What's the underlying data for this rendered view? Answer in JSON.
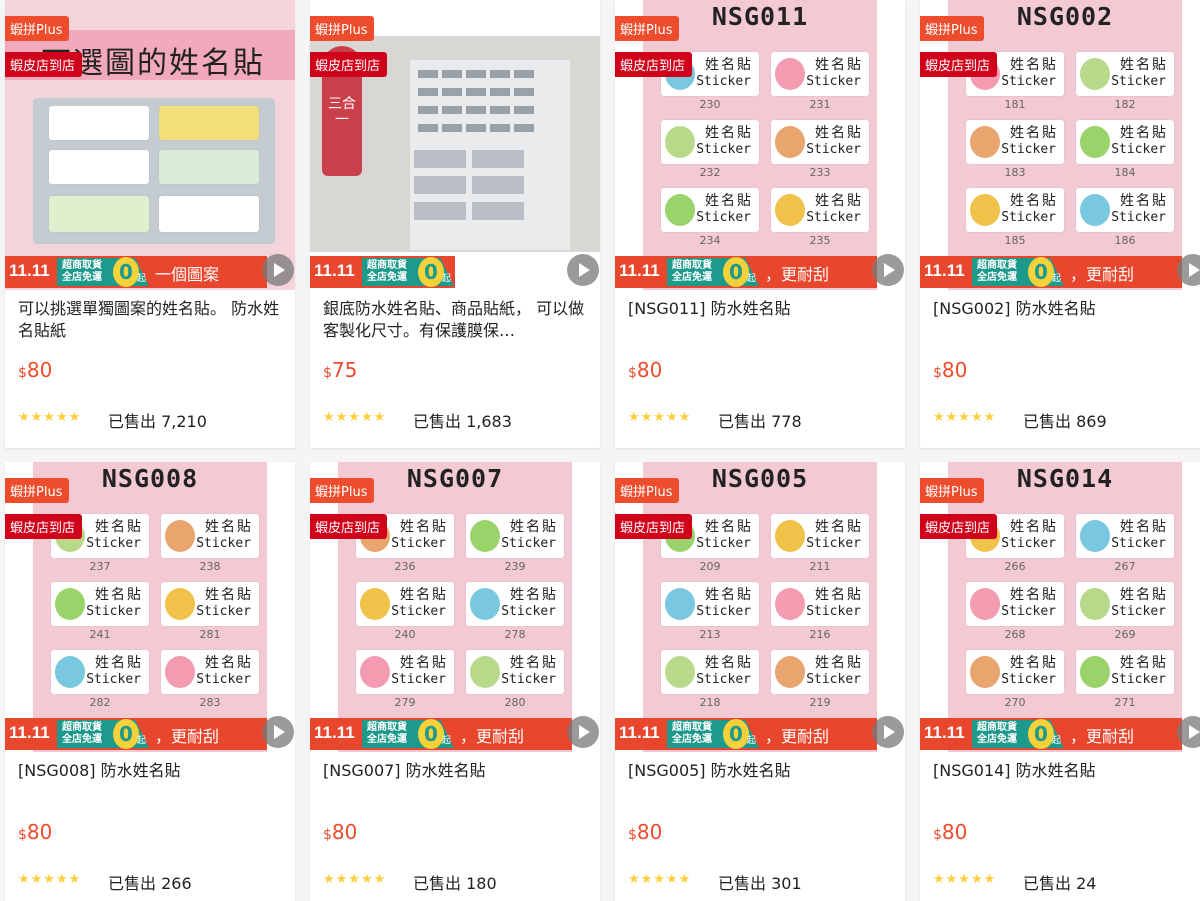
{
  "colors": {
    "brand": "#ee4d2d",
    "promo": "#e8472e",
    "teal": "#1d9a8c",
    "star": "#ffce3d"
  },
  "cards": [
    {
      "tag_plus": "蝦拼Plus",
      "tag_shop": "蝦皮店到店",
      "thumb_heading": "可選圖的姓名貼",
      "promo": {
        "event": "11.11",
        "ship1": "超商取貨",
        "ship2": "全店免運",
        "zero": "0",
        "qi": "起",
        "tail": "一個圖案"
      },
      "title": "可以挑選單獨圖案的姓名貼。 防水姓名貼紙",
      "currency": "$",
      "price": "80",
      "stars": "★★★★★",
      "sold": "已售出 7,210"
    },
    {
      "tag_plus": "蝦拼Plus",
      "tag_shop": "蝦皮店到店",
      "thumb_side": "三合一",
      "promo": {
        "event": "11.11",
        "ship1": "超商取貨",
        "ship2": "全店免運",
        "zero": "0",
        "qi": "起",
        "tail": ""
      },
      "title": "銀底防水姓名貼、商品貼紙， 可以做客製化尺寸。有保護膜保…",
      "currency": "$",
      "price": "75",
      "stars": "★★★★★",
      "sold": "已售出 1,683"
    },
    {
      "tag_plus": "蝦拼Plus",
      "tag_shop": "蝦皮店到店",
      "code": "NSG011",
      "stickers": [
        {
          "name": "姓名貼",
          "en": "Sticker",
          "num": "230"
        },
        {
          "name": "姓名貼",
          "en": "Sticker",
          "num": "231"
        },
        {
          "name": "姓名貼",
          "en": "Sticker",
          "num": "232"
        },
        {
          "name": "姓名貼",
          "en": "Sticker",
          "num": "233"
        },
        {
          "name": "姓名貼",
          "en": "Sticker",
          "num": "234"
        },
        {
          "name": "姓名貼",
          "en": "Sticker",
          "num": "235"
        }
      ],
      "promo": {
        "event": "11.11",
        "ship1": "超商取貨",
        "ship2": "全店免運",
        "zero": "0",
        "qi": "起",
        "tail": "，更耐刮"
      },
      "title": "[NSG011] 防水姓名貼",
      "currency": "$",
      "price": "80",
      "stars": "★★★★★",
      "sold": "已售出 778"
    },
    {
      "tag_plus": "蝦拼Plus",
      "tag_shop": "蝦皮店到店",
      "code": "NSG002",
      "stickers": [
        {
          "name": "姓名貼",
          "en": "Sticker",
          "num": "181"
        },
        {
          "name": "姓名貼",
          "en": "Sticker",
          "num": "182"
        },
        {
          "name": "姓名貼",
          "en": "Sticker",
          "num": "183"
        },
        {
          "name": "姓名貼",
          "en": "Sticker",
          "num": "184"
        },
        {
          "name": "姓名貼",
          "en": "Sticker",
          "num": "185"
        },
        {
          "name": "姓名貼",
          "en": "Sticker",
          "num": "186"
        }
      ],
      "promo": {
        "event": "11.11",
        "ship1": "超商取貨",
        "ship2": "全店免運",
        "zero": "0",
        "qi": "起",
        "tail": "，更耐刮"
      },
      "title": "[NSG002] 防水姓名貼",
      "currency": "$",
      "price": "80",
      "stars": "★★★★★",
      "sold": "已售出 869"
    },
    {
      "tag_plus": "蝦拼Plus",
      "tag_shop": "蝦皮店到店",
      "code": "NSG008",
      "stickers": [
        {
          "name": "姓名貼",
          "en": "Sticker",
          "num": "237"
        },
        {
          "name": "姓名貼",
          "en": "Sticker",
          "num": "238"
        },
        {
          "name": "姓名貼",
          "en": "Sticker",
          "num": "241"
        },
        {
          "name": "姓名貼",
          "en": "Sticker",
          "num": "281"
        },
        {
          "name": "姓名貼",
          "en": "Sticker",
          "num": "282"
        },
        {
          "name": "姓名貼",
          "en": "Sticker",
          "num": "283"
        }
      ],
      "promo": {
        "event": "11.11",
        "ship1": "超商取貨",
        "ship2": "全店免運",
        "zero": "0",
        "qi": "起",
        "tail": "，更耐刮"
      },
      "title": "[NSG008] 防水姓名貼",
      "currency": "$",
      "price": "80",
      "stars": "★★★★★",
      "sold": "已售出 266"
    },
    {
      "tag_plus": "蝦拼Plus",
      "tag_shop": "蝦皮店到店",
      "code": "NSG007",
      "stickers": [
        {
          "name": "姓名貼",
          "en": "Sticker",
          "num": "236"
        },
        {
          "name": "姓名貼",
          "en": "Sticker",
          "num": "239"
        },
        {
          "name": "姓名貼",
          "en": "Sticker",
          "num": "240"
        },
        {
          "name": "姓名貼",
          "en": "Sticker",
          "num": "278"
        },
        {
          "name": "姓名貼",
          "en": "Sticker",
          "num": "279"
        },
        {
          "name": "姓名貼",
          "en": "Sticker",
          "num": "280"
        }
      ],
      "promo": {
        "event": "11.11",
        "ship1": "超商取貨",
        "ship2": "全店免運",
        "zero": "0",
        "qi": "起",
        "tail": "，更耐刮"
      },
      "title": "[NSG007] 防水姓名貼",
      "currency": "$",
      "price": "80",
      "stars": "★★★★★",
      "sold": "已售出 180"
    },
    {
      "tag_plus": "蝦拼Plus",
      "tag_shop": "蝦皮店到店",
      "code": "NSG005",
      "stickers": [
        {
          "name": "姓名貼",
          "en": "Sticker",
          "num": "209"
        },
        {
          "name": "姓名貼",
          "en": "Sticker",
          "num": "211"
        },
        {
          "name": "姓名貼",
          "en": "Sticker",
          "num": "213"
        },
        {
          "name": "姓名貼",
          "en": "Sticker",
          "num": "216"
        },
        {
          "name": "姓名貼",
          "en": "Sticker",
          "num": "218"
        },
        {
          "name": "姓名貼",
          "en": "Sticker",
          "num": "219"
        }
      ],
      "promo": {
        "event": "11.11",
        "ship1": "超商取貨",
        "ship2": "全店免運",
        "zero": "0",
        "qi": "起",
        "tail": "，更耐刮"
      },
      "title": "[NSG005] 防水姓名貼",
      "currency": "$",
      "price": "80",
      "stars": "★★★★★",
      "sold": "已售出 301"
    },
    {
      "tag_plus": "蝦拼Plus",
      "tag_shop": "蝦皮店到店",
      "code": "NSG014",
      "stickers": [
        {
          "name": "姓名貼",
          "en": "Sticker",
          "num": "266"
        },
        {
          "name": "姓名貼",
          "en": "Sticker",
          "num": "267"
        },
        {
          "name": "姓名貼",
          "en": "Sticker",
          "num": "268"
        },
        {
          "name": "姓名貼",
          "en": "Sticker",
          "num": "269"
        },
        {
          "name": "姓名貼",
          "en": "Sticker",
          "num": "270"
        },
        {
          "name": "姓名貼",
          "en": "Sticker",
          "num": "271"
        }
      ],
      "promo": {
        "event": "11.11",
        "ship1": "超商取貨",
        "ship2": "全店免運",
        "zero": "0",
        "qi": "起",
        "tail": "，更耐刮"
      },
      "title": "[NSG014] 防水姓名貼",
      "currency": "$",
      "price": "80",
      "stars": "★★★★★",
      "sold": "已售出 24"
    }
  ]
}
